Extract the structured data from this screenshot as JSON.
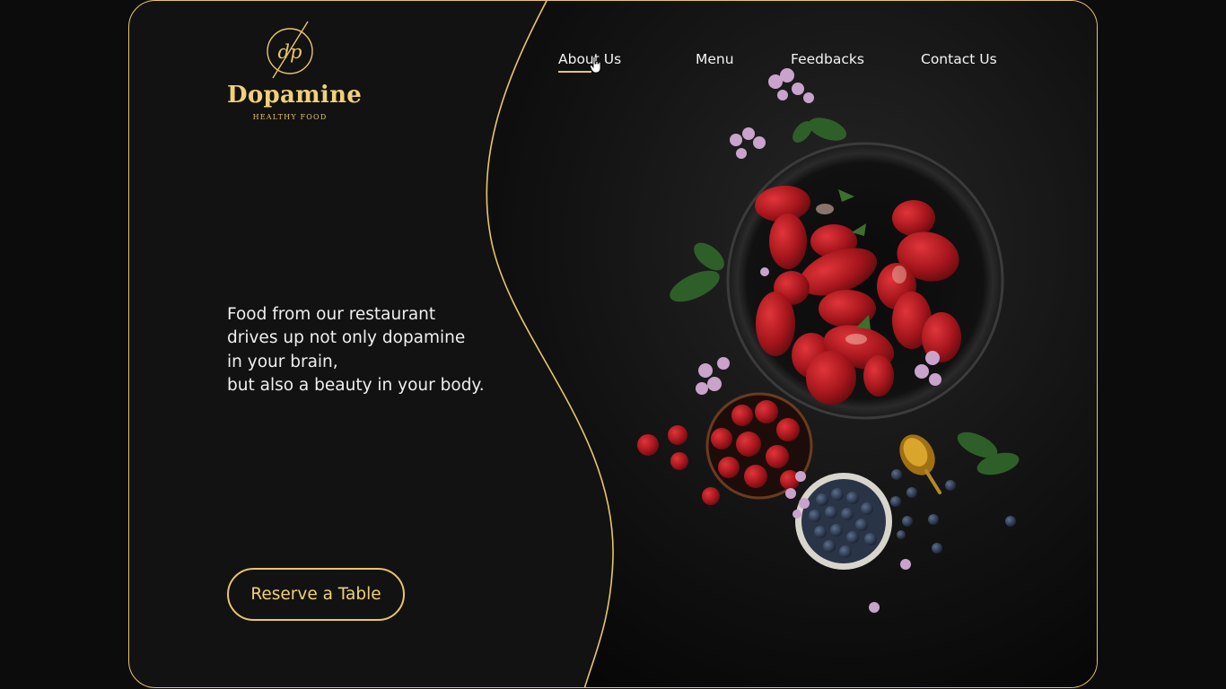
{
  "brand": {
    "name": "Dopamine",
    "subtitle": "HEALTHY  FOOD",
    "monogram": "dp",
    "accent_color": "#e9c667"
  },
  "nav": {
    "items": [
      {
        "label": "About Us",
        "active": true
      },
      {
        "label": "Menu",
        "active": false
      },
      {
        "label": "Feedbacks",
        "active": false
      },
      {
        "label": "Contact Us",
        "active": false
      }
    ]
  },
  "hero": {
    "tagline_lines": [
      "Food from our restaurant",
      "drives up not only dopamine",
      "in your brain,",
      "but also a beauty in your body."
    ],
    "cta_label": "Reserve a Table",
    "image_subject": "strawberries-blueberries-lilac-flatlay"
  }
}
